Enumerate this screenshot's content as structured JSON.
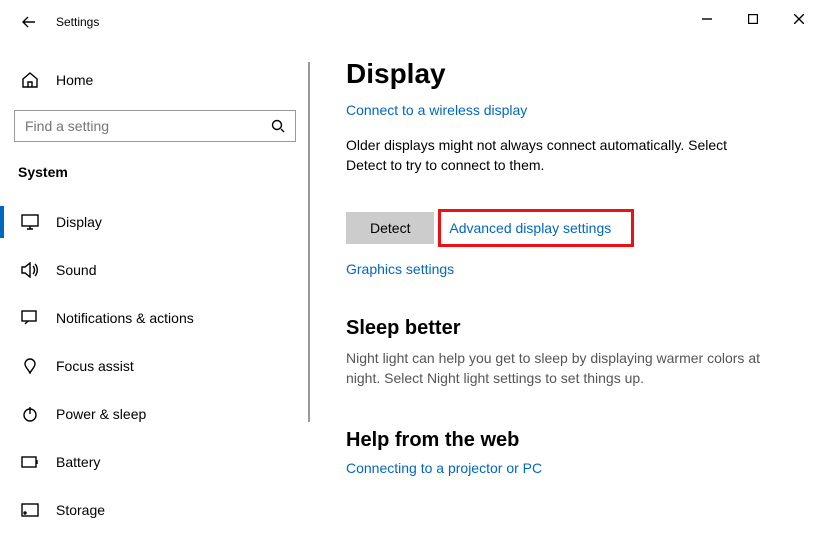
{
  "window": {
    "title": "Settings"
  },
  "sidebar": {
    "home": "Home",
    "search_placeholder": "Find a setting",
    "section": "System",
    "items": [
      {
        "label": "Display"
      },
      {
        "label": "Sound"
      },
      {
        "label": "Notifications & actions"
      },
      {
        "label": "Focus assist"
      },
      {
        "label": "Power & sleep"
      },
      {
        "label": "Battery"
      },
      {
        "label": "Storage"
      }
    ]
  },
  "main": {
    "title": "Display",
    "link_wireless": "Connect to a wireless display",
    "detect_desc": "Older displays might not always connect automatically. Select Detect to try to connect to them.",
    "detect_button": "Detect",
    "link_advanced": "Advanced display settings",
    "link_graphics": "Graphics settings",
    "sleep_heading": "Sleep better",
    "sleep_desc": "Night light can help you get to sleep by displaying warmer colors at night. Select Night light settings to set things up.",
    "help_heading": "Help from the web",
    "link_projector": "Connecting to a projector or PC"
  }
}
